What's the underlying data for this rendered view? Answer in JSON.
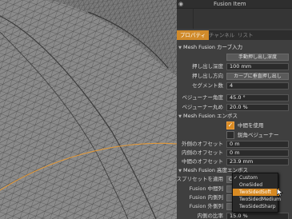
{
  "item_list": {
    "item_name": "Fusion Item",
    "eye_icon": "eye-icon"
  },
  "tabs": [
    {
      "label": "プロパティ",
      "active": true
    },
    {
      "label": "チャンネル",
      "active": false
    },
    {
      "label": "リスト",
      "active": false
    }
  ],
  "sections": {
    "strip": "Mesh Fusion カーブ入力",
    "emboss": "Mesh Fusion エンボス",
    "advanced": "Mesh Fusion 高度エンボス"
  },
  "strip_rows": {
    "auto_depth_button": "手動押し出し深度",
    "extrude_depth_label": "押し出し深度",
    "extrude_depth_value": "100 mm",
    "extrude_dir_label": "押し出し方向",
    "extrude_dir_value": "カーブに垂直押し出し",
    "segments_label": "セグメント数",
    "segments_value": "4",
    "bezier_angle_label": "ベジューナー角度",
    "bezier_angle_value": "45.0 °",
    "bezier_round_label": "ベジューナー丸め",
    "bezier_round_value": "20.0 %"
  },
  "emboss_rows": {
    "use_middle_label": "中間を使用",
    "use_middle_checked": true,
    "linear_bezier_label": "鋭角ベジューナー",
    "outer_offset_label": "外側のオフセット",
    "outer_offset_value": "0 m",
    "inner_offset_label": "内側のオフセット",
    "inner_offset_value": "0 m",
    "middle_offset_label": "中間のオフセット",
    "middle_offset_value": "23.9 mm"
  },
  "advanced_rows": {
    "preset_label": "エンボスプリセットを適用",
    "preset_value": "Cu",
    "middle_label": "Fusion 中間列",
    "inner_label": "Fusion 内側列",
    "outer_label": "Fusion 外側列",
    "ratio_label": "内側の比率",
    "ratio_value": "15.0 %"
  },
  "preset_options": [
    {
      "label": "Custom",
      "checked": true,
      "highlight": false
    },
    {
      "label": "OneSided",
      "checked": false,
      "highlight": false
    },
    {
      "label": "TwoSidedSoft",
      "checked": false,
      "highlight": true
    },
    {
      "label": "TwoSidedMedium",
      "checked": false,
      "highlight": false
    },
    {
      "label": "TwoSidedSharp",
      "checked": false,
      "highlight": false
    }
  ],
  "colors": {
    "accent": "#d88a22",
    "viewport": "#808080",
    "panel": "#3f3f3f"
  }
}
